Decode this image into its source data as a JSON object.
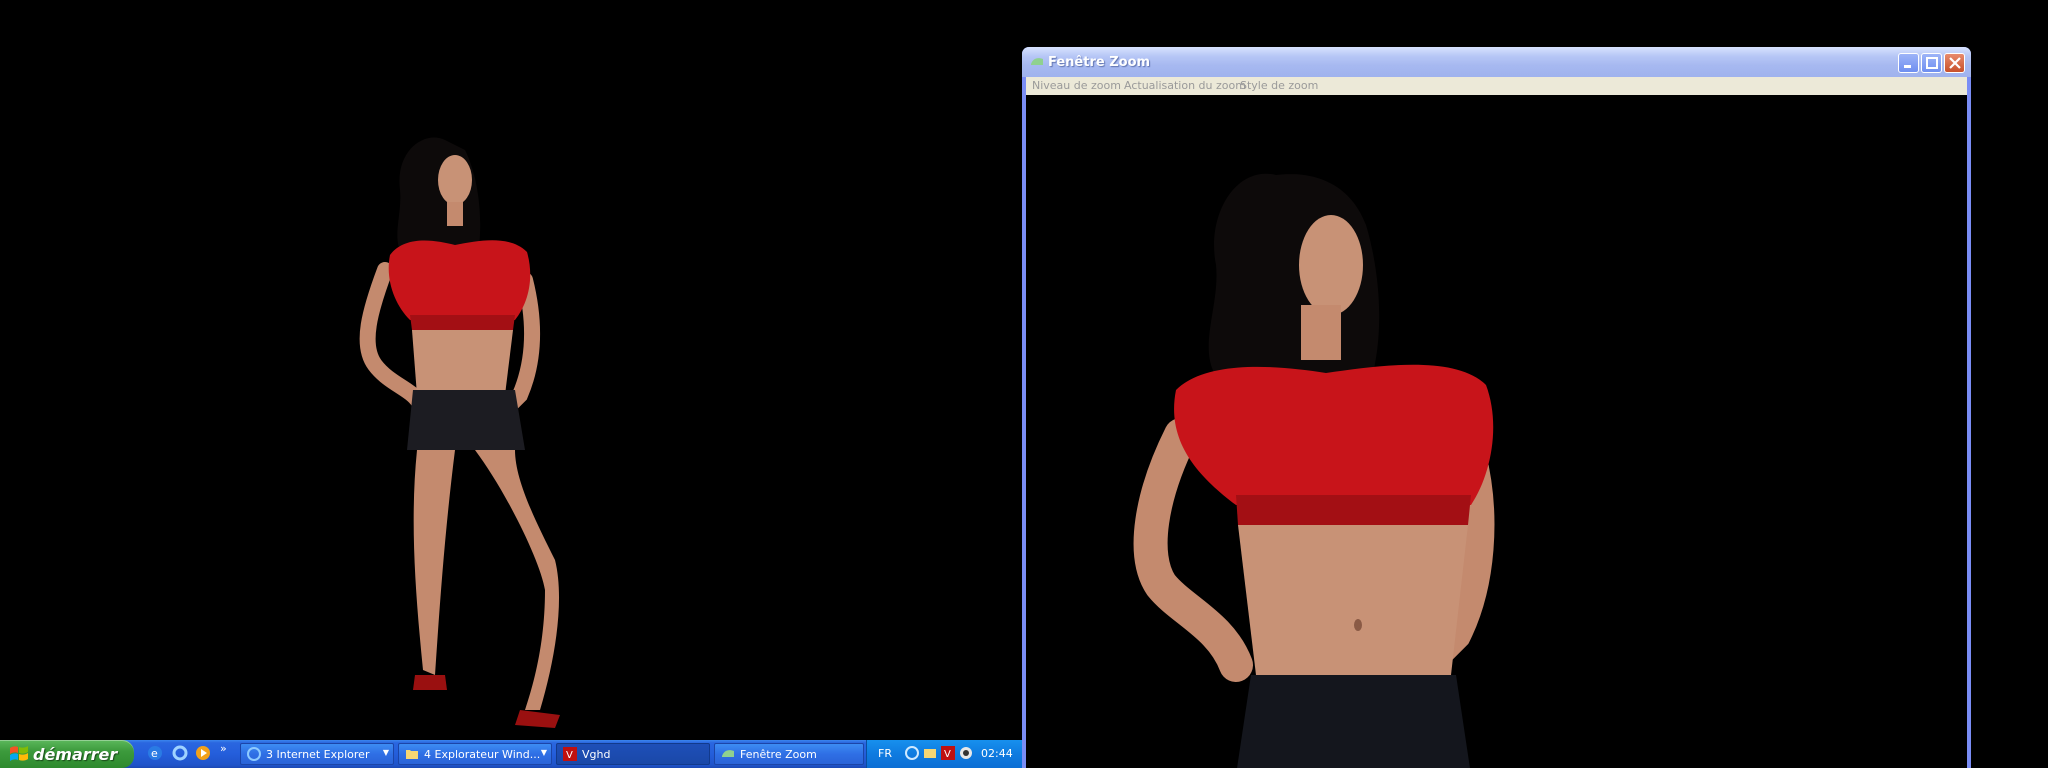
{
  "taskbar": {
    "start_label": "démarrer",
    "tasks": [
      {
        "label": "3 Internet Explorer",
        "icon": "ie-icon",
        "has_group_arrow": true
      },
      {
        "label": "4 Explorateur Wind...",
        "icon": "folder-icon",
        "has_group_arrow": true
      },
      {
        "label": "Vghd",
        "icon": "vghd-icon",
        "has_group_arrow": false,
        "active": true
      },
      {
        "label": "Fenêtre Zoom",
        "icon": "zoom-window-icon",
        "has_group_arrow": false
      }
    ],
    "quick_launch": [
      "ie-icon",
      "refresh-icon",
      "media-icon"
    ],
    "tray": {
      "language": "FR",
      "icons": [
        "network-icon",
        "folder-tray-icon",
        "vghd-tray-icon",
        "speaker-icon"
      ],
      "clock": "02:44"
    }
  },
  "zoom_window": {
    "title": "Fenêtre Zoom",
    "menu": [
      "Niveau de zoom",
      "Actualisation du zoom",
      "Style de zoom"
    ],
    "controls": [
      "minimize-icon",
      "maximize-icon",
      "close-icon"
    ]
  },
  "colors": {
    "taskbar_blue": "#245edb",
    "start_green": "#3c9a3c",
    "titlebar_inactive": "#a7b9f0",
    "top_red": "#c8141a"
  }
}
